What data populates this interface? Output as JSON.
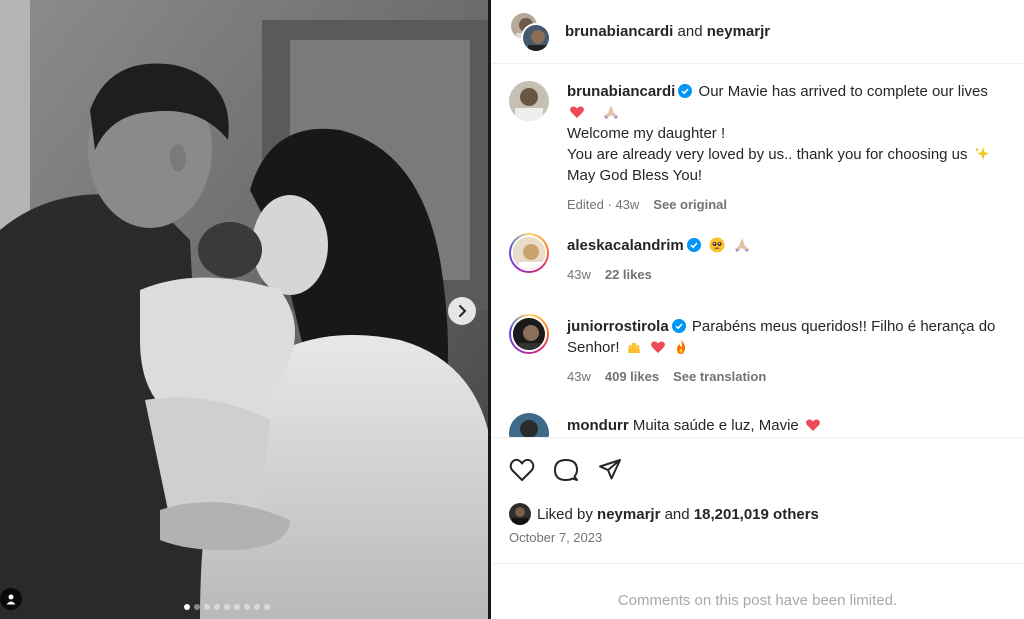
{
  "post": {
    "header": {
      "author": "brunabiancardi",
      "connector": "and",
      "collaborator": "neymarjr"
    },
    "caption": {
      "username": "brunabiancardi",
      "line1": "Our Mavie has arrived to complete our lives",
      "line2": "Welcome my daughter !",
      "line3": "You are already very loved by us.. thank you for choosing us",
      "line4": "May God Bless You!",
      "edited": "Edited",
      "age": "43w",
      "see_original": "See original"
    },
    "comments": [
      {
        "username": "aleskacalandrim",
        "text": "",
        "age": "43w",
        "likes": "22 likes"
      },
      {
        "username": "juniorrostirola",
        "text_line1": "Parabéns meus queridos!! Filho é herança do",
        "text_line2": "Senhor!",
        "age": "43w",
        "likes": "409 likes",
        "see_translation": "See translation"
      },
      {
        "username": "mondurr",
        "text": "Muita saúde e luz, Mavie"
      }
    ],
    "liked_by": {
      "prefix": "Liked by",
      "user": "neymarjr",
      "and": "and",
      "others": "18,201,019 others"
    },
    "date": "October 7, 2023",
    "limited_notice": "Comments on this post have been limited.",
    "carousel": {
      "count": 9,
      "active": 0
    }
  },
  "icons": {
    "heart": "heart-icon",
    "comment": "comment-icon",
    "share": "share-icon",
    "next": "chevron-right-icon",
    "tag": "person-tag-icon",
    "verified": "verified-badge-icon"
  },
  "colors": {
    "verified": "#0095f6",
    "heart_red": "#ed4956",
    "muted": "#737373"
  }
}
